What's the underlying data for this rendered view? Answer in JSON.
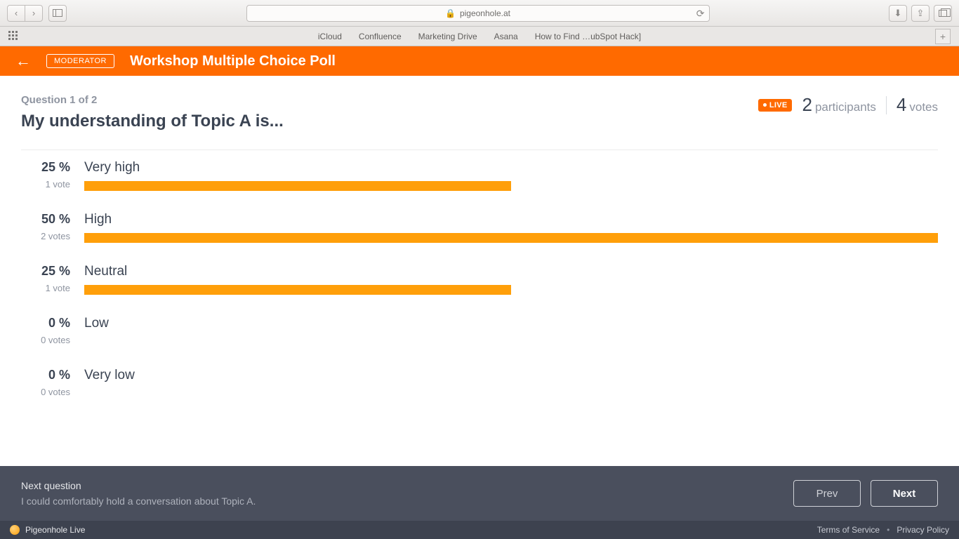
{
  "browser": {
    "url_host": "pigeonhole.at",
    "favorites": [
      "iCloud",
      "Confluence",
      "Marketing Drive",
      "Asana",
      "How to Find …ubSpot Hack]"
    ]
  },
  "header": {
    "moderator_badge": "MODERATOR",
    "title": "Workshop Multiple Choice Poll"
  },
  "status": {
    "live_label": "LIVE",
    "participants_count": "2",
    "participants_label": "participants",
    "votes_count": "4",
    "votes_label": "votes"
  },
  "question": {
    "position": "Question 1 of 2",
    "text": "My understanding of Topic A is..."
  },
  "options": [
    {
      "pct": "25 %",
      "votes": "1 vote",
      "label": "Very high",
      "bar_pct": 50
    },
    {
      "pct": "50 %",
      "votes": "2 votes",
      "label": "High",
      "bar_pct": 100
    },
    {
      "pct": "25 %",
      "votes": "1 vote",
      "label": "Neutral",
      "bar_pct": 50
    },
    {
      "pct": "0 %",
      "votes": "0 votes",
      "label": "Low",
      "bar_pct": 0
    },
    {
      "pct": "0 %",
      "votes": "0 votes",
      "label": "Very low",
      "bar_pct": 0
    }
  ],
  "next_bar": {
    "heading": "Next question",
    "text": "I could comfortably hold a conversation about Topic A.",
    "prev_label": "Prev",
    "next_label": "Next"
  },
  "footer": {
    "brand": "Pigeonhole Live",
    "terms": "Terms of Service",
    "privacy": "Privacy Policy"
  },
  "chart_data": {
    "type": "bar",
    "orientation": "horizontal",
    "categories": [
      "Very high",
      "High",
      "Neutral",
      "Low",
      "Very low"
    ],
    "values": [
      25,
      50,
      25,
      0,
      0
    ],
    "votes": [
      1,
      2,
      1,
      0,
      0
    ],
    "unit": "percent",
    "xlim": [
      0,
      100
    ],
    "title": "My understanding of Topic A is..."
  }
}
